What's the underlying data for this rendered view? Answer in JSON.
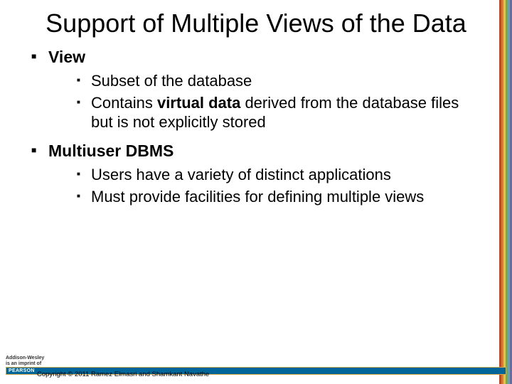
{
  "title": "Support of Multiple Views of the Data",
  "bullets": {
    "b1": {
      "heading": "View",
      "sub1": "Subset of the database",
      "sub2_pre": "Contains ",
      "sub2_bold": "virtual data",
      "sub2_post": " derived from the database files but is not explicitly stored"
    },
    "b2": {
      "heading": "Multiuser DBMS",
      "sub1": "Users have a variety of distinct applications",
      "sub2": "Must provide facilities for defining multiple views"
    }
  },
  "footer": {
    "imprint1": "Addison-Wesley",
    "imprint2": "is an imprint of",
    "publisher": "PEARSON",
    "copyright": "Copyright © 2011 Ramez Elmasri and Shamkant Navathe"
  }
}
